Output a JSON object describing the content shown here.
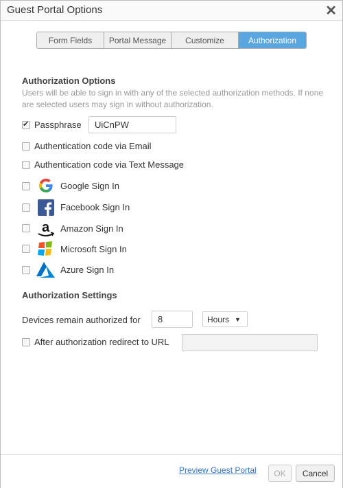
{
  "dialog": {
    "title": "Guest Portal Options",
    "close_glyph": "✕"
  },
  "tabs": [
    {
      "label": "Form Fields",
      "active": false
    },
    {
      "label": "Portal Message",
      "active": false
    },
    {
      "label": "Customize",
      "active": false
    },
    {
      "label": "Authorization",
      "active": true
    }
  ],
  "auth_options": {
    "title": "Authorization Options",
    "description": "Users will be able to sign in with any of the selected authorization methods. If none are selected users may sign in without authorization.",
    "items": [
      {
        "label": "Passphrase",
        "checked": true,
        "value": "UiCnPW"
      },
      {
        "label": "Authentication code via Email",
        "checked": false
      },
      {
        "label": "Authentication code via Text Message",
        "checked": false
      },
      {
        "label": "Google Sign In",
        "checked": false,
        "icon": "google-icon"
      },
      {
        "label": "Facebook Sign In",
        "checked": false,
        "icon": "facebook-icon"
      },
      {
        "label": "Amazon Sign In",
        "checked": false,
        "icon": "amazon-icon"
      },
      {
        "label": "Microsoft Sign In",
        "checked": false,
        "icon": "microsoft-icon"
      },
      {
        "label": "Azure Sign In",
        "checked": false,
        "icon": "azure-icon"
      }
    ]
  },
  "auth_settings": {
    "title": "Authorization Settings",
    "devices_label": "Devices remain authorized for",
    "devices_value": "8",
    "unit_selected": "Hours",
    "redirect_label": "After authorization redirect to URL",
    "redirect_checked": false,
    "redirect_value": ""
  },
  "footer": {
    "preview_link": "Preview Guest Portal",
    "ok_label": "OK",
    "cancel_label": "Cancel"
  },
  "colors": {
    "accent": "#5aa6e0",
    "link": "#3b78c2"
  }
}
